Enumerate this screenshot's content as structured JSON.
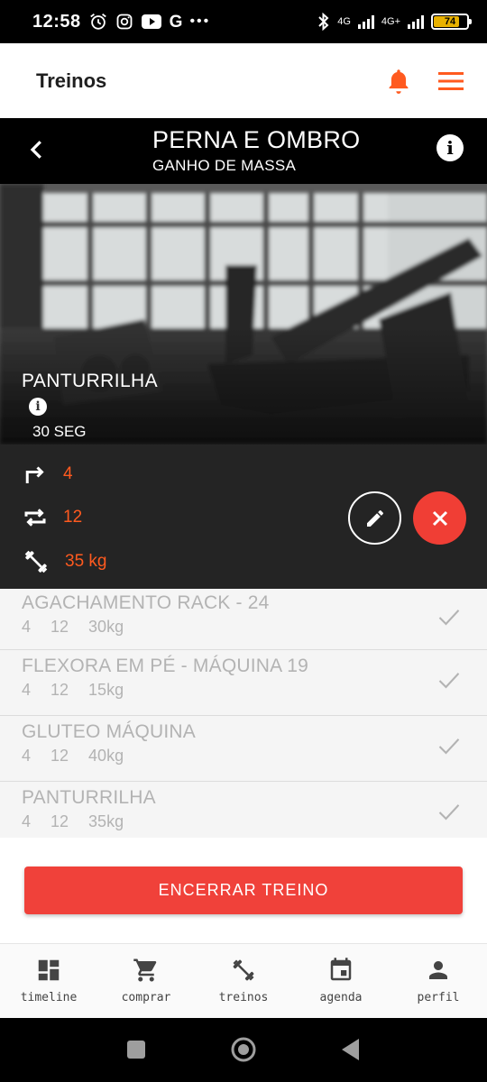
{
  "status_bar": {
    "time": "12:58",
    "battery_level": "74",
    "network_1": "4G",
    "network_2": "4G+",
    "app_icons": [
      "alarm-icon",
      "instagram-icon",
      "youtube-icon",
      "google-icon",
      "more-icon"
    ]
  },
  "app_header": {
    "title": "Treinos",
    "accent_color": "#ff5a1f"
  },
  "workout": {
    "name": "PERNA E OMBRO",
    "goal": "GANHO DE MASSA"
  },
  "current_exercise": {
    "name": "PANTURRILHA",
    "rest": "30 SEG",
    "sets": "4",
    "reps": "12",
    "weight": "35 kg"
  },
  "completed_exercises": [
    {
      "name": "AGACHAMENTO RACK - 24",
      "sets": "4",
      "reps": "12",
      "weight": "30kg"
    },
    {
      "name": "FLEXORA EM PÉ - MÁQUINA 19",
      "sets": "4",
      "reps": "12",
      "weight": "15kg"
    },
    {
      "name": "GLUTEO MÁQUINA",
      "sets": "4",
      "reps": "12",
      "weight": "40kg"
    },
    {
      "name": "PANTURRILHA",
      "sets": "4",
      "reps": "12",
      "weight": "35kg"
    }
  ],
  "end_button": "ENCERRAR TREINO",
  "bottom_nav": [
    {
      "label": "timeline",
      "icon": "dashboard-icon"
    },
    {
      "label": "comprar",
      "icon": "cart-icon"
    },
    {
      "label": "treinos",
      "icon": "dumbbell-icon"
    },
    {
      "label": "agenda",
      "icon": "calendar-icon"
    },
    {
      "label": "perfil",
      "icon": "person-icon"
    }
  ]
}
